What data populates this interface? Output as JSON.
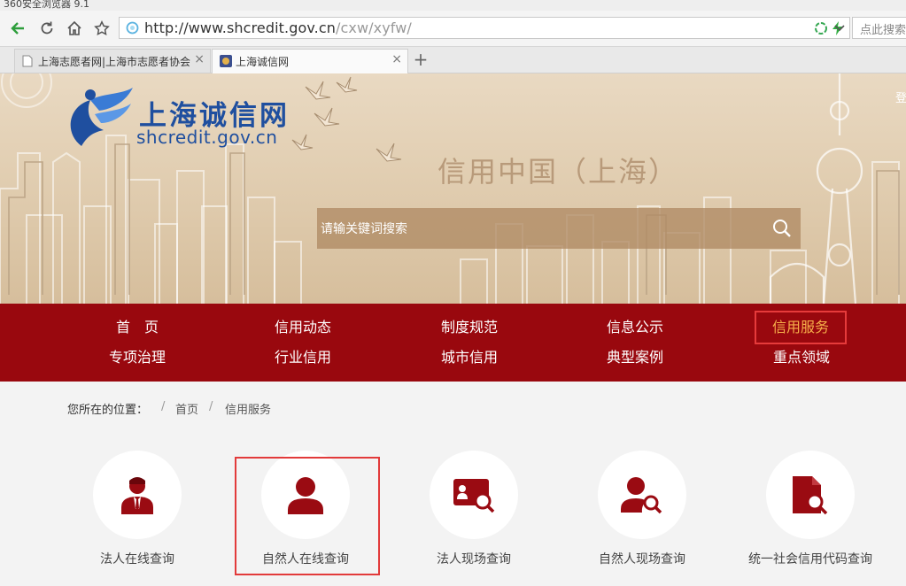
{
  "browser": {
    "title": "360安全浏览器 9.1",
    "url_host": "http://www.shcredit.gov.cn",
    "url_path": "/cxw/xyfw/",
    "search_placeholder": "点此搜索",
    "tabs": [
      {
        "label": "上海志愿者网|上海市志愿者协会",
        "active": false
      },
      {
        "label": "上海诚信网",
        "active": true
      }
    ],
    "new_tab": "+",
    "close_glyph": "×"
  },
  "banner": {
    "logo_cn": "上海诚信网",
    "logo_en": "shcredit.gov.cn",
    "title": "信用中国（上海）",
    "search_placeholder": "请输关键词搜索",
    "login_peek": "登"
  },
  "nav": {
    "row1": [
      "首　页",
      "信用动态",
      "制度规范",
      "信息公示",
      "信用服务"
    ],
    "row2": [
      "专项治理",
      "行业信用",
      "城市信用",
      "典型案例",
      "重点领域"
    ]
  },
  "breadcrumb": {
    "label": "您所在的位置：",
    "sep": "/",
    "items": [
      "首页",
      "信用服务"
    ]
  },
  "services": [
    {
      "label": "法人在线查询",
      "icon": "businessman-icon"
    },
    {
      "label": "自然人在线查询",
      "icon": "person-icon"
    },
    {
      "label": "法人现场查询",
      "icon": "id-card-search-icon"
    },
    {
      "label": "自然人现场查询",
      "icon": "person-search-icon"
    },
    {
      "label": "统一社会信用代码查询",
      "icon": "document-search-icon"
    }
  ],
  "colors": {
    "nav_bg": "#99080e",
    "highlight": "#e23a3a",
    "icon_red": "#9a0b12",
    "active_nav_text": "#f7b04a",
    "logo_blue": "#1f4f9f"
  }
}
